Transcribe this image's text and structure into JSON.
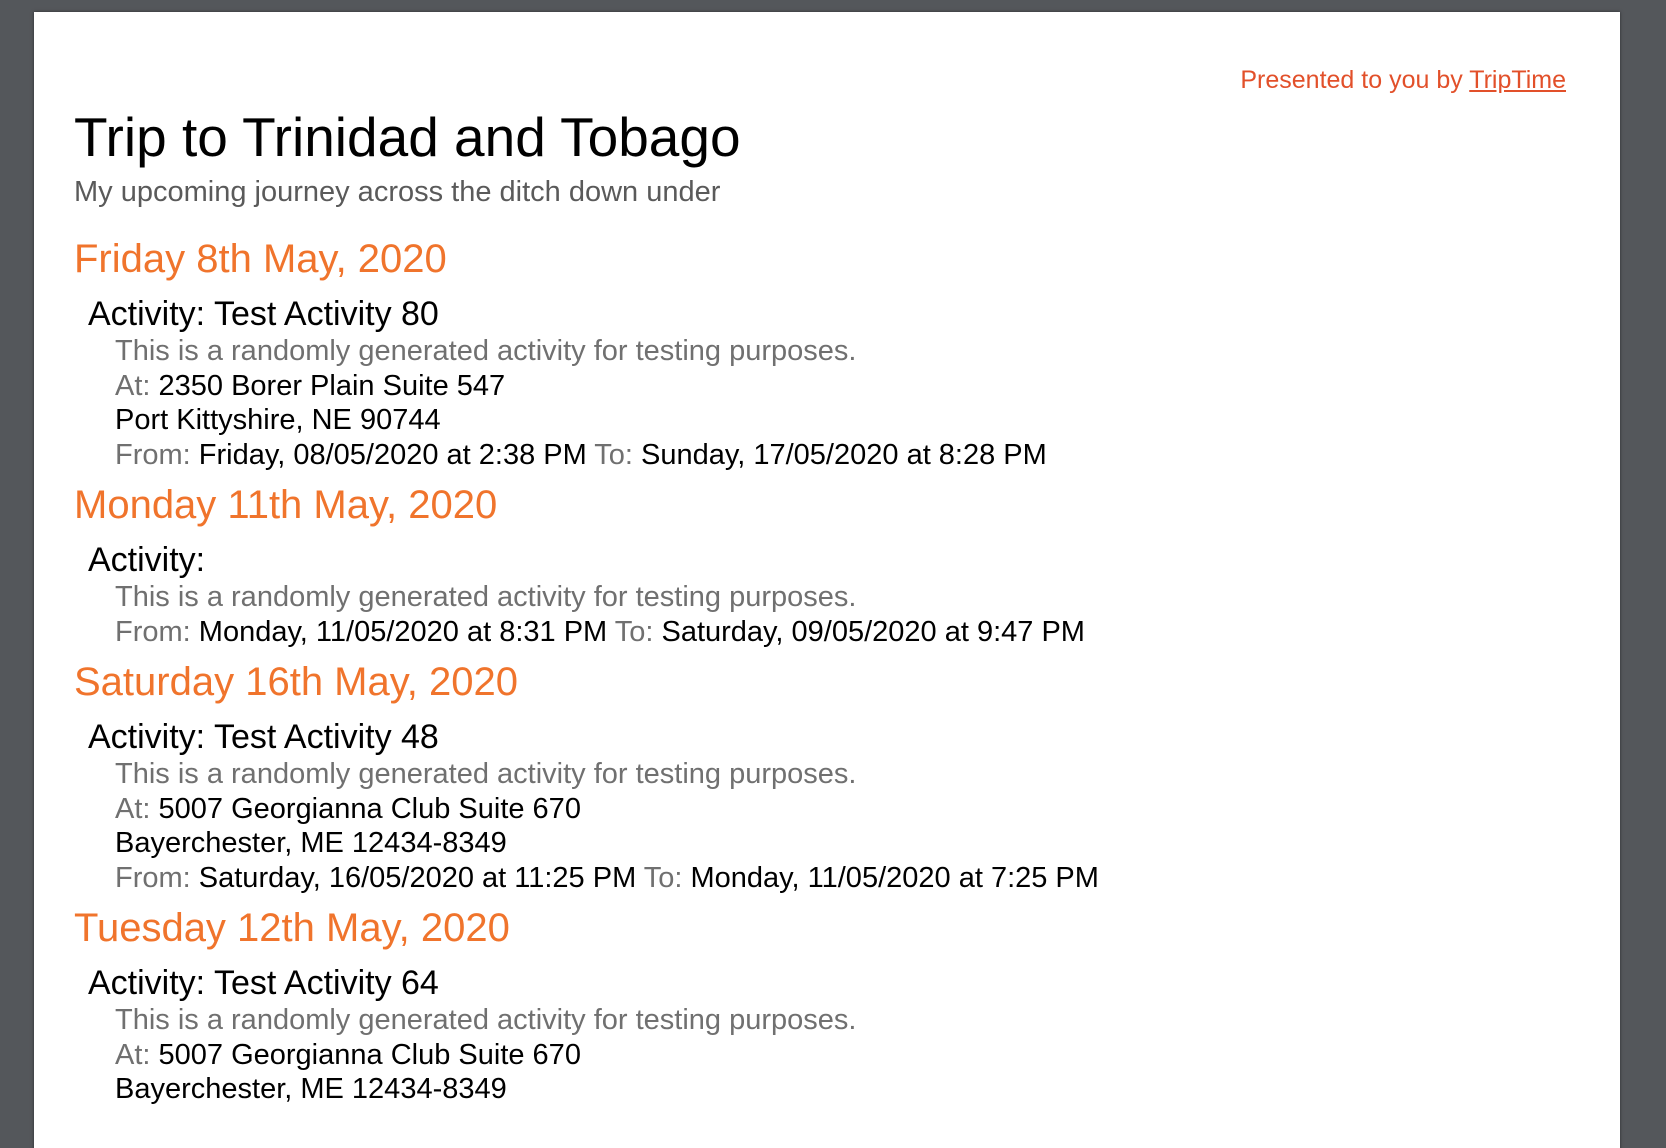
{
  "header": {
    "presented_prefix": "Presented to you by ",
    "presented_link": "TripTime"
  },
  "trip": {
    "title": "Trip to Trinidad and Tobago",
    "subtitle": "My upcoming journey across the ditch down under"
  },
  "labels": {
    "activity": "Activity: ",
    "at": "At: ",
    "from": "From: ",
    "to": " To: "
  },
  "days": [
    {
      "heading": "Friday 8th May, 2020",
      "activity": {
        "name": "Test Activity 80",
        "description": "This is a randomly generated activity for testing purposes.",
        "address_line1": "2350 Borer Plain Suite 547",
        "address_line2": "Port Kittyshire, NE 90744",
        "from": "Friday, 08/05/2020 at 2:38 PM",
        "to": "Sunday, 17/05/2020 at 8:28 PM"
      }
    },
    {
      "heading": "Monday 11th May, 2020",
      "activity": {
        "name": "",
        "description": "This is a randomly generated activity for testing purposes.",
        "from": "Monday, 11/05/2020 at 8:31 PM",
        "to": "Saturday, 09/05/2020 at 9:47 PM"
      }
    },
    {
      "heading": "Saturday 16th May, 2020",
      "activity": {
        "name": "Test Activity 48",
        "description": "This is a randomly generated activity for testing purposes.",
        "address_line1": "5007 Georgianna Club Suite 670",
        "address_line2": "Bayerchester, ME 12434-8349",
        "from": "Saturday, 16/05/2020 at 11:25 PM",
        "to": "Monday, 11/05/2020 at 7:25 PM"
      }
    },
    {
      "heading": "Tuesday 12th May, 2020",
      "activity": {
        "name": "Test Activity 64",
        "description": "This is a randomly generated activity for testing purposes.",
        "address_line1": "5007 Georgianna Club Suite 670",
        "address_line2": "Bayerchester, ME 12434-8349"
      }
    }
  ]
}
